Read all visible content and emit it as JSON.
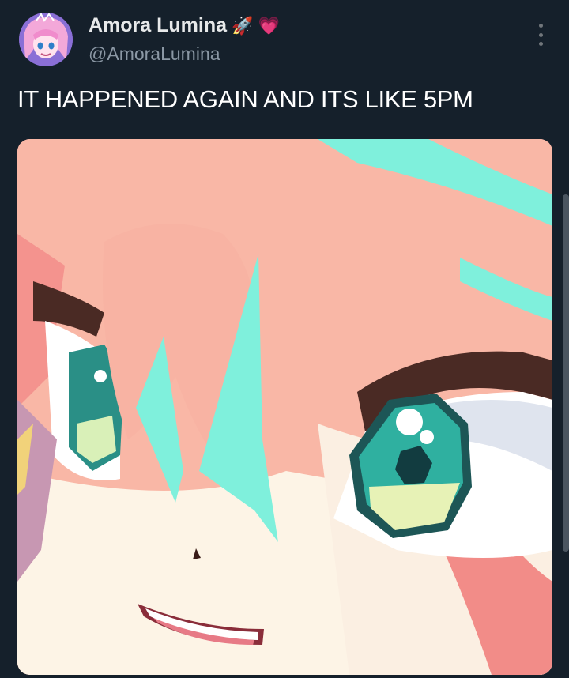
{
  "author": {
    "display_name": "Amora Lumina",
    "badges": [
      "🚀",
      "💗"
    ],
    "handle": "@AmoraLumina"
  },
  "tweet": {
    "text": "IT HAPPENED AGAIN AND ITS LIKE 5PM"
  },
  "media": {
    "type": "image",
    "subject": "anime-character-face-closeup"
  },
  "icons": {
    "more": "more-vertical-icon"
  },
  "colors": {
    "background": "#15202b",
    "text_primary": "#e7e9ea",
    "text_secondary": "#8b98a5",
    "hair_pink": "#f7b8a8",
    "hair_aqua": "#7ff0dc"
  }
}
